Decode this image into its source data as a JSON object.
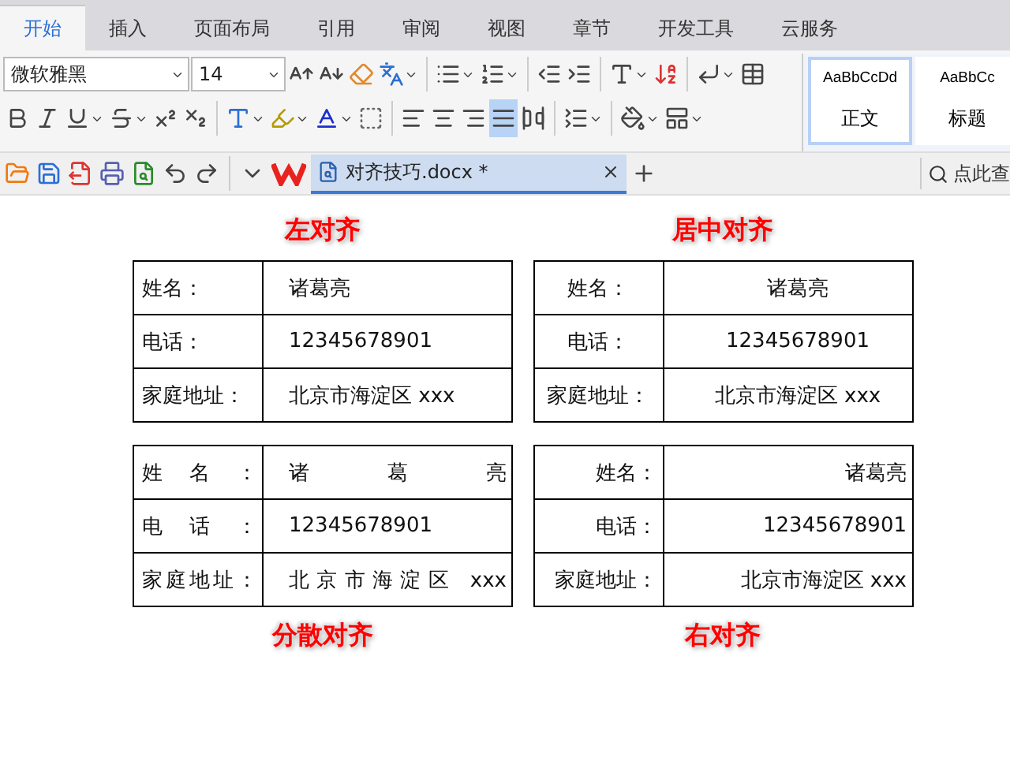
{
  "ribbon_tabs": [
    {
      "label": "开始",
      "selected": true
    },
    {
      "label": "插入",
      "selected": false
    },
    {
      "label": "页面布局",
      "selected": false
    },
    {
      "label": "引用",
      "selected": false
    },
    {
      "label": "审阅",
      "selected": false
    },
    {
      "label": "视图",
      "selected": false
    },
    {
      "label": "章节",
      "selected": false
    },
    {
      "label": "开发工具",
      "selected": false
    },
    {
      "label": "云服务",
      "selected": false
    }
  ],
  "font": {
    "name": "微软雅黑",
    "size": "14"
  },
  "alignment_buttons": [
    {
      "kind": "left",
      "selected": false
    },
    {
      "kind": "center",
      "selected": false
    },
    {
      "kind": "right",
      "selected": false
    },
    {
      "kind": "justify",
      "selected": true
    },
    {
      "kind": "distributed",
      "selected": false
    }
  ],
  "styles": [
    {
      "sample": "AaBbCcDd",
      "label": "正文",
      "selected": true
    },
    {
      "sample": "AaBbCc",
      "label": "标题",
      "selected": false
    }
  ],
  "document_tab": {
    "title": "对齐技巧.docx *"
  },
  "search": {
    "placeholder": "点此查"
  },
  "top_tables": [
    {
      "caption": "左对齐",
      "kind": "left",
      "rows": [
        {
          "label": "姓名：",
          "value": "诸葛亮"
        },
        {
          "label": "电话：",
          "value": "12345678901"
        },
        {
          "label": "家庭地址：",
          "value": "北京市海淀区 xxx"
        }
      ]
    },
    {
      "caption": "居中对齐",
      "kind": "center",
      "rows": [
        {
          "label": "姓名：",
          "value": "诸葛亮"
        },
        {
          "label": "电话：",
          "value": "12345678901"
        },
        {
          "label": "家庭地址：",
          "value": "北京市海淀区 xxx"
        }
      ]
    }
  ],
  "bottom_tables": [
    {
      "caption": "分散对齐",
      "kind": "distributed",
      "rows": [
        {
          "label": "姓名：",
          "value": "诸葛亮"
        },
        {
          "label": "电话：",
          "value": "12345678901"
        },
        {
          "label": "家庭地址：",
          "value": "北京市海淀区 xxx"
        }
      ]
    },
    {
      "caption": "右对齐",
      "kind": "right",
      "rows": [
        {
          "label": "姓名：",
          "value": "诸葛亮"
        },
        {
          "label": "电话：",
          "value": "12345678901"
        },
        {
          "label": "家庭地址：",
          "value": "北京市海淀区 xxx"
        }
      ]
    }
  ]
}
